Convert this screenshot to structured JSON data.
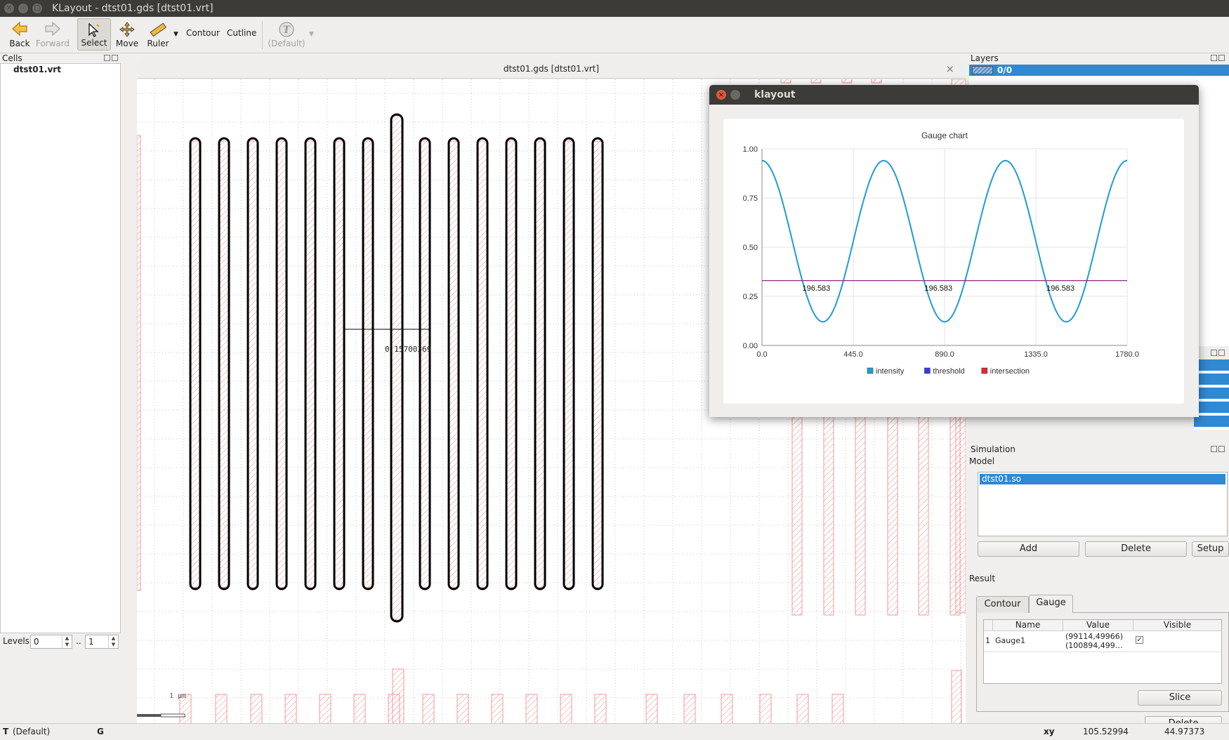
{
  "window": {
    "title": "KLayout  - dtst01.gds [dtst01.vrt]"
  },
  "toolbar": {
    "back": "Back",
    "forward": "Forward",
    "select": "Select",
    "move": "Move",
    "ruler": "Ruler",
    "contour": "Contour",
    "cutline": "Cutline",
    "text_default": "(Default)"
  },
  "cells": {
    "title": "Cells",
    "item": "dtst01.vrt"
  },
  "levels": {
    "label": "Levels",
    "from": "0",
    "sep": "..",
    "to": "1"
  },
  "layout_tab": {
    "title": "dtst01.gds [dtst01.vrt]"
  },
  "canvas": {
    "ruler_label": "0.15700369",
    "scale_label": "1 µm"
  },
  "layers": {
    "title": "Layers",
    "item": "0/0"
  },
  "dialog": {
    "title": "klayout"
  },
  "chart_data": {
    "type": "line",
    "title": "Gauge chart",
    "xlabel": "",
    "ylabel": "",
    "xlim": [
      0,
      1780
    ],
    "ylim": [
      0,
      1.0
    ],
    "xticks": [
      "0.0",
      "445.0",
      "890.0",
      "1335.0",
      "1780.0"
    ],
    "yticks": [
      "0.00",
      "0.25",
      "0.50",
      "0.75",
      "1.00"
    ],
    "grid": true,
    "legend": "bottom",
    "series": [
      {
        "name": "intensity",
        "color": "#1f9bd7",
        "function": "cosine",
        "mean": 0.53,
        "amplitude": 0.41,
        "period": 593.3,
        "phase_x": 0
      },
      {
        "name": "threshold",
        "color": "#3b39e6",
        "x": [
          0,
          1780
        ],
        "y": [
          0.33,
          0.33
        ]
      },
      {
        "name": "intersection",
        "color": "#e3262e",
        "x": [
          0,
          1780
        ],
        "y": [
          0.33,
          0.33
        ]
      }
    ],
    "annotations": [
      {
        "text": "196.583",
        "x": 265,
        "y": 0.31
      },
      {
        "text": "196.583",
        "x": 860,
        "y": 0.31
      },
      {
        "text": "196.583",
        "x": 1455,
        "y": 0.31
      }
    ]
  },
  "simulation": {
    "title": "Simulation",
    "model_label": "Model",
    "model_item": "dtst01.so",
    "add": "Add",
    "delete": "Delete",
    "setup": "Setup"
  },
  "result": {
    "label": "Result",
    "tabs": [
      "Contour",
      "Gauge"
    ],
    "table": {
      "headers": [
        "Name",
        "Value",
        "Visible"
      ],
      "rows": [
        {
          "index": "1",
          "name": "Gauge1",
          "value1": "(99114,49966)",
          "value2": "(100894,499…",
          "visible": "✓"
        }
      ]
    },
    "slice": "Slice",
    "delete": "Delete"
  },
  "status": {
    "text_default": "(Default)",
    "xy_label": "xy",
    "x": "105.52994",
    "y": "44.97373"
  }
}
